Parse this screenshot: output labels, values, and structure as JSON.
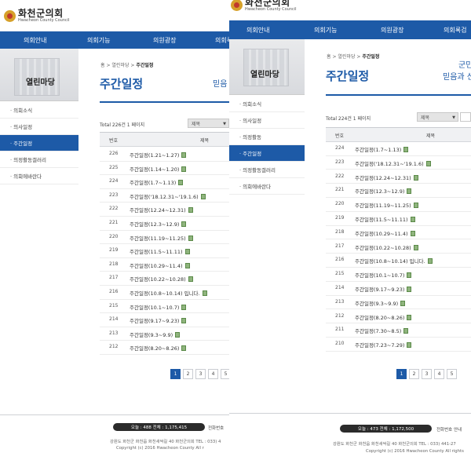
{
  "brand": {
    "name_kr": "화천군의회",
    "name_en": "Hwacheon County Council"
  },
  "nav": [
    "의회안내",
    "의회기능",
    "의원광장",
    "의회록검"
  ],
  "sidebar": {
    "title": "열린마당",
    "items": [
      "· 의회소식",
      "· 의사일정",
      "· 주간일정",
      "· 의정활동갤러리",
      "· 의회에바란다"
    ],
    "items_right": [
      "· 의회소식",
      "· 의사일정",
      "· 의정활동",
      "· 주간일정",
      "· 의정활동갤러리",
      "· 의회에바란다"
    ]
  },
  "breadcrumb": {
    "home": "홈",
    "sep": ">",
    "section": "열린마당",
    "current": "주간일정"
  },
  "page": {
    "title": "주간일정",
    "slogan_left": "믿음",
    "slogan_right_line1": "군민",
    "slogan_right_line2": "믿음과 신"
  },
  "list_left": {
    "total": "Total 226건 1 페이지",
    "select": "제목",
    "headers": {
      "num": "번호",
      "title": "제목"
    },
    "rows": [
      {
        "num": "226",
        "title": "주간일정(1.21~1.27)"
      },
      {
        "num": "225",
        "title": "주간일정(1.14~1.20)"
      },
      {
        "num": "224",
        "title": "주간일정(1.7~1.13)"
      },
      {
        "num": "223",
        "title": "주간일정('18.12.31~'19.1.6)"
      },
      {
        "num": "222",
        "title": "주간일정(12.24~12.31)"
      },
      {
        "num": "221",
        "title": "주간일정(12.3~12.9)"
      },
      {
        "num": "220",
        "title": "주간일정(11.19~11.25)"
      },
      {
        "num": "219",
        "title": "주간일정(11.5~11.11)"
      },
      {
        "num": "218",
        "title": "주간일정(10.29~11.4)"
      },
      {
        "num": "217",
        "title": "주간일정(10.22~10.28)"
      },
      {
        "num": "216",
        "title": "주간일정(10.8~10.14) 입니다."
      },
      {
        "num": "215",
        "title": "주간일정(10.1~10.7)"
      },
      {
        "num": "214",
        "title": "주간일정(9.17~9.23)"
      },
      {
        "num": "213",
        "title": "주간일정(9.3~9.9)"
      },
      {
        "num": "212",
        "title": "주간일정(8.20~8.26)"
      }
    ],
    "pages": [
      "1",
      "2",
      "3",
      "4",
      "5"
    ]
  },
  "list_right": {
    "total": "Total 224건 1 페이지",
    "select": "제목",
    "headers": {
      "num": "번호",
      "title": "제목"
    },
    "rows": [
      {
        "num": "224",
        "title": "주간일정(1.7~1.13)"
      },
      {
        "num": "223",
        "title": "주간일정('18.12.31~'19.1.6)"
      },
      {
        "num": "222",
        "title": "주간일정(12.24~12.31)"
      },
      {
        "num": "221",
        "title": "주간일정(12.3~12.9)"
      },
      {
        "num": "220",
        "title": "주간일정(11.19~11.25)"
      },
      {
        "num": "219",
        "title": "주간일정(11.5~11.11)"
      },
      {
        "num": "218",
        "title": "주간일정(10.29~11.4)"
      },
      {
        "num": "217",
        "title": "주간일정(10.22~10.28)"
      },
      {
        "num": "216",
        "title": "주간일정(10.8~10.14) 입니다."
      },
      {
        "num": "215",
        "title": "주간일정(10.1~10.7)"
      },
      {
        "num": "214",
        "title": "주간일정(9.17~9.23)"
      },
      {
        "num": "213",
        "title": "주간일정(9.3~9.9)"
      },
      {
        "num": "212",
        "title": "주간일정(8.20~8.26)"
      },
      {
        "num": "211",
        "title": "주간일정(7.30~8.5)"
      },
      {
        "num": "210",
        "title": "주간일정(7.23~7.29)"
      }
    ],
    "pages": [
      "1",
      "2",
      "3",
      "4",
      "5"
    ]
  },
  "footer_left": {
    "counter": "오늘 : 488   전체 : 1,175,415",
    "link": "전화번호",
    "address": "강원도 화천군 화천읍 화천새싹길 40 화천군의회 TEL : 033) 4",
    "copyright": "Copyright (c) 2016 Hwacheon County All r"
  },
  "footer_right": {
    "counter": "오늘 : 473   전체 : 1,172,500",
    "link": "전화번호 안내",
    "address": "강원도 화천군 화천읍 화천새싹길 40 화천군의회 TEL : 033) 441-27",
    "copyright": "Copyright (c) 2016 Hwacheon County All rights"
  },
  "colors": {
    "brand_blue": "#1d5aa7",
    "counter_bg": "#2b2b2b",
    "header_bg": "#f0f1f3"
  }
}
